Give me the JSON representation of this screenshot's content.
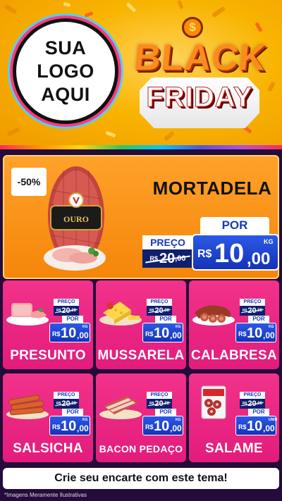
{
  "header": {
    "logo_lines": [
      "SUA",
      "LOGO",
      "AQUI"
    ],
    "badge_symbol": "$",
    "title_line1": "BLACK",
    "title_line2": "FRIDAY"
  },
  "hero": {
    "discount": "-50%",
    "product": "MORTADELA",
    "brand_label": "OURO",
    "old_label": "PREÇO",
    "old_currency": "R$",
    "old_int": "20",
    "old_cents": ",00",
    "new_label": "POR",
    "new_currency": "R$",
    "new_int": "10",
    "new_cents": ",00",
    "unit": "KG"
  },
  "products": [
    {
      "name": "PRESUNTO",
      "old_label": "PREÇO",
      "old_currency": "R$",
      "old_int": "20",
      "old_cents": ",00",
      "new_label": "POR",
      "new_currency": "R$",
      "new_int": "10",
      "new_cents": ",00",
      "unit": "KG"
    },
    {
      "name": "MUSSARELA",
      "old_label": "PREÇO",
      "old_currency": "R$",
      "old_int": "20",
      "old_cents": ",00",
      "new_label": "POR",
      "new_currency": "R$",
      "new_int": "10",
      "new_cents": ",00",
      "unit": "KG"
    },
    {
      "name": "CALABRESA",
      "old_label": "PREÇO",
      "old_currency": "R$",
      "old_int": "20",
      "old_cents": ",00",
      "new_label": "POR",
      "new_currency": "R$",
      "new_int": "10",
      "new_cents": ",00",
      "unit": "KG"
    },
    {
      "name": "SALSICHA",
      "old_label": "PREÇO",
      "old_currency": "R$",
      "old_int": "20",
      "old_cents": ",00",
      "new_label": "POR",
      "new_currency": "R$",
      "new_int": "10",
      "new_cents": ",00",
      "unit": "KG"
    },
    {
      "name": "BACON PEDAÇO",
      "old_label": "PREÇO",
      "old_currency": "R$",
      "old_int": "20",
      "old_cents": ",00",
      "new_label": "POR",
      "new_currency": "R$",
      "new_int": "10",
      "new_cents": ",00",
      "unit": "KG"
    },
    {
      "name": "SALAME",
      "old_label": "PREÇO",
      "old_currency": "R$",
      "old_int": "20",
      "old_cents": ",00",
      "new_label": "POR",
      "new_currency": "R$",
      "new_int": "10",
      "new_cents": ",00",
      "unit": "UNID"
    }
  ],
  "footer": {
    "cta": "Crie seu encarte com este tema!",
    "disclaimer": "*Imagens Meramente Ilustrativas"
  },
  "colors": {
    "header_yellow": "#f8b400",
    "hero_orange": "#f5860a",
    "card_pink": "#e31c7c",
    "price_blue": "#1433b8",
    "old_price_navy": "#0f1f6e"
  }
}
